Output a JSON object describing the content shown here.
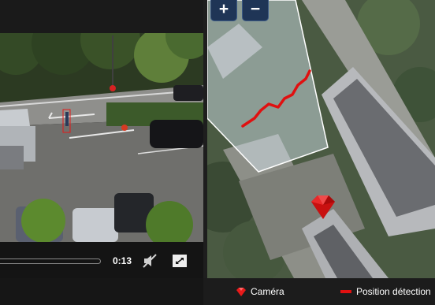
{
  "player": {
    "time": "0:13",
    "progress": 0.0,
    "mute_icon": "muted-speaker-icon",
    "fullscreen_icon": "fullscreen-icon"
  },
  "map": {
    "zoom_in_label": "+",
    "zoom_out_label": "−",
    "path_color": "#e01010",
    "marker_color": "#e81a1a"
  },
  "legend": {
    "camera_label": "Caméra",
    "detection_label": "Position détection"
  }
}
